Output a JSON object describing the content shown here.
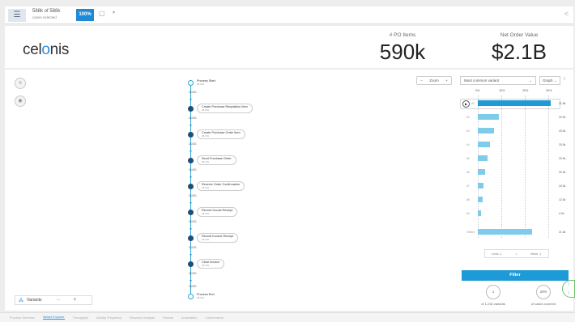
{
  "topbar": {
    "sel_main": "588k of 588k",
    "sel_sub": "cases selected",
    "percent": "100%"
  },
  "header": {
    "logo": {
      "pre": "cel",
      "accent": "o",
      "post": "nis"
    },
    "kpis": [
      {
        "label": "# PO Items",
        "value": "590k"
      },
      {
        "label": "Net Order Value",
        "value": "$2.1B"
      }
    ]
  },
  "process": {
    "start": {
      "label": "Process Start",
      "sub": "28,001"
    },
    "counts": [
      "28,001",
      "28,001",
      "28,001",
      "28,001",
      "28,001",
      "28,001",
      "28,001",
      "28,001",
      "28,001"
    ],
    "steps": [
      {
        "label": "Create Purchase Requisition Item",
        "sub": "28,001"
      },
      {
        "label": "Create Purchase Order Item",
        "sub": "28,001"
      },
      {
        "label": "Send Purchase Order",
        "sub": "28,001"
      },
      {
        "label": "Receive Order Confirmation",
        "sub": "28,001"
      },
      {
        "label": "Record Goods Receipt",
        "sub": "28,001"
      },
      {
        "label": "Record Invoice Receipt",
        "sub": "28,001"
      },
      {
        "label": "Clear Invoice",
        "sub": "28,001"
      }
    ],
    "end": {
      "label": "Process End",
      "sub": "28,001"
    }
  },
  "zoom": {
    "label": "Zoom"
  },
  "variants_panel": {
    "dropdown": "Most common variant",
    "graph_dropdown": "Graph",
    "ticks": [
      "0%",
      "10%",
      "20%",
      "30%"
    ],
    "rows": [
      {
        "label": "#1",
        "value": "21.5k",
        "pct": 31
      },
      {
        "label": "#2",
        "value": "20.0k",
        "pct": 9
      },
      {
        "label": "#3",
        "value": "20.0k",
        "pct": 7
      },
      {
        "label": "#4",
        "value": "20.0k",
        "pct": 5
      },
      {
        "label": "#5",
        "value": "20.0k",
        "pct": 4
      },
      {
        "label": "#6",
        "value": "20.0k",
        "pct": 3
      },
      {
        "label": "#7",
        "value": "20.0k",
        "pct": 2.5
      },
      {
        "label": "#8",
        "value": "12.0k",
        "pct": 2
      },
      {
        "label": "#9",
        "value": "4.0k",
        "pct": 1.5
      },
      {
        "label": "Others",
        "value": "21.6k",
        "pct": 23
      }
    ],
    "less": "Less",
    "more": "More",
    "filter": "Filter",
    "circle1": "1",
    "circle1_label": "of 1,234 variants",
    "circle2": "24%",
    "circle2_label": "of cases covered"
  },
  "variants_bar": {
    "label": "Variants"
  },
  "tabs": [
    "Process Overview",
    "Variant Explorer",
    "Throughput",
    "Activity Frequency",
    "Resource Analysis",
    "Rework",
    "Automation",
    "Conformance"
  ],
  "colors": {
    "accent": "#1e9ad6",
    "bar": "#7fcbec",
    "node": "#1e4f7a"
  }
}
